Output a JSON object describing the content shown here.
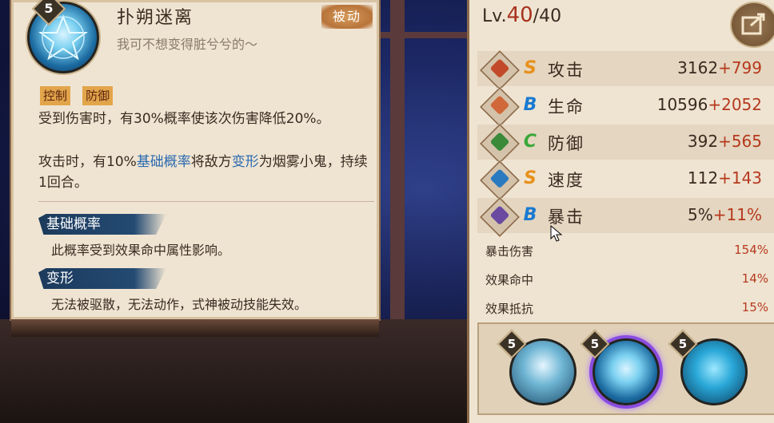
{
  "skill": {
    "level": "5",
    "name": "扑朔迷离",
    "quote": "我可不想变得脏兮兮的～",
    "type_tag": "被动",
    "tags": [
      "控制",
      "防御"
    ],
    "desc1": "受到伤害时，有30%概率使该次伤害降低20%。",
    "desc2_pre": "攻击时，有10%",
    "desc2_kw1": "基础概率",
    "desc2_mid": "将敌方",
    "desc2_kw2": "变形",
    "desc2_post": "为烟雾小鬼，持续1回合。",
    "term1_title": "基础概率",
    "term1_text": "此概率受到效果命中属性影响。",
    "term2_title": "变形",
    "term2_text": "无法被驱散，无法动作，式神被动技能失效。"
  },
  "stats": {
    "lv_label": "Lv.",
    "lv_current": "40",
    "lv_max": "/40",
    "rows": [
      {
        "grade": "S",
        "name": "攻击",
        "base": "3162",
        "bonus": "+799",
        "icon": "attack-icon",
        "color": "#c24a2a",
        "grade_color": "#e8901a"
      },
      {
        "grade": "B",
        "name": "生命",
        "base": "10596",
        "bonus": "+2052",
        "icon": "health-icon",
        "color": "#d0683a",
        "grade_color": "#1a7ad0"
      },
      {
        "grade": "C",
        "name": "防御",
        "base": "392",
        "bonus": "+565",
        "icon": "defense-icon",
        "color": "#3a8a3a",
        "grade_color": "#3aa83a"
      },
      {
        "grade": "S",
        "name": "速度",
        "base": "112",
        "bonus": "+143",
        "icon": "speed-icon",
        "color": "#2a7ac0",
        "grade_color": "#e8901a"
      },
      {
        "grade": "B",
        "name": "暴击",
        "base": "5%",
        "bonus": "+11%",
        "icon": "crit-icon",
        "color": "#6a4aa0",
        "grade_color": "#1a7ad0"
      }
    ],
    "sub": [
      {
        "name": "暴击伤害",
        "value": "154%"
      },
      {
        "name": "效果命中",
        "value": "14%"
      },
      {
        "name": "效果抵抗",
        "value": "15%"
      }
    ]
  },
  "tray": {
    "levels": [
      "5",
      "5",
      "5"
    ]
  }
}
